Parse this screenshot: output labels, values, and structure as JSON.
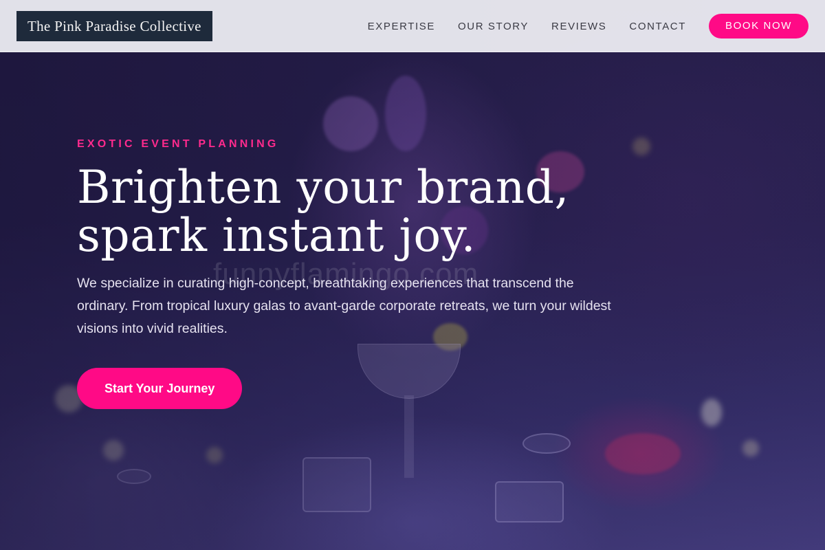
{
  "header": {
    "logo_text": "The Pink Paradise Collective",
    "nav": [
      {
        "label": "EXPERTISE"
      },
      {
        "label": "OUR STORY"
      },
      {
        "label": "REVIEWS"
      },
      {
        "label": "CONTACT"
      }
    ],
    "book_label": "BOOK NOW"
  },
  "hero": {
    "eyebrow": "EXOTIC EVENT PLANNING",
    "headline_line1": "Brighten your brand,",
    "headline_line2": "spark instant joy.",
    "intro": "We specialize in curating high-concept, breathtaking experiences that transcend the ordinary. From tropical luxury galas to avant-garde corporate retreats, we turn your wildest visions into vivid realities.",
    "cta_label": "Start Your Journey",
    "watermark": "funnyflamingo.com"
  },
  "colors": {
    "accent": "#ff0a86",
    "eyebrow": "#ff2a8d",
    "logo_bg": "#1e2a3b",
    "header_bg": "#ececf2"
  }
}
